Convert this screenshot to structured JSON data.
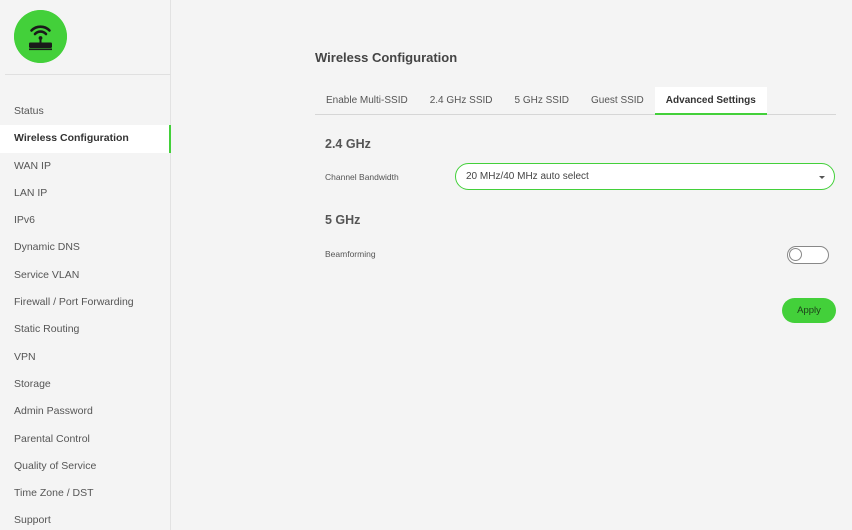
{
  "sidebar": {
    "logo_icon": "router-icon",
    "items": [
      {
        "label": "Status"
      },
      {
        "label": "Wireless Configuration"
      },
      {
        "label": "WAN IP"
      },
      {
        "label": "LAN IP"
      },
      {
        "label": "IPv6"
      },
      {
        "label": "Dynamic DNS"
      },
      {
        "label": "Service VLAN"
      },
      {
        "label": "Firewall / Port Forwarding"
      },
      {
        "label": "Static Routing"
      },
      {
        "label": "VPN"
      },
      {
        "label": "Storage"
      },
      {
        "label": "Admin Password"
      },
      {
        "label": "Parental Control"
      },
      {
        "label": "Quality of Service"
      },
      {
        "label": "Time Zone / DST"
      },
      {
        "label": "Support"
      }
    ],
    "active_item": "Wireless Configuration"
  },
  "main": {
    "title": "Wireless Configuration",
    "tabs": [
      {
        "label": "Enable Multi-SSID"
      },
      {
        "label": "2.4 GHz SSID"
      },
      {
        "label": "5 GHz SSID"
      },
      {
        "label": "Guest SSID"
      },
      {
        "label": "Advanced Settings"
      }
    ],
    "active_tab": "Advanced Settings",
    "section_24": {
      "heading": "2.4 GHz",
      "channel_bandwidth_label": "Channel Bandwidth",
      "channel_bandwidth_value": "20 MHz/40 MHz auto select"
    },
    "section_5": {
      "heading": "5 GHz",
      "beamforming_label": "Beamforming",
      "beamforming_enabled": false
    },
    "apply_label": "Apply"
  },
  "colors": {
    "accent": "#43d03a",
    "background": "#f4f4f4"
  }
}
